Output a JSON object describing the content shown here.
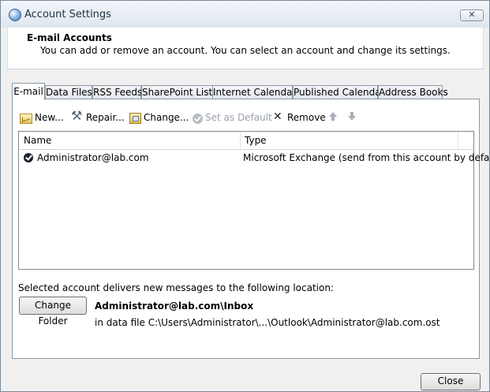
{
  "window": {
    "title": "Account Settings",
    "close_glyph": "✕"
  },
  "header": {
    "title": "E-mail Accounts",
    "description": "You can add or remove an account. You can select an account and change its settings."
  },
  "tabs": [
    {
      "label": "E-mail",
      "active": true
    },
    {
      "label": "Data Files",
      "active": false
    },
    {
      "label": "RSS Feeds",
      "active": false
    },
    {
      "label": "SharePoint Lists",
      "active": false
    },
    {
      "label": "Internet Calendars",
      "active": false
    },
    {
      "label": "Published Calendars",
      "active": false
    },
    {
      "label": "Address Books",
      "active": false
    }
  ],
  "toolbar": {
    "new_label": "New...",
    "repair_label": "Repair...",
    "change_label": "Change...",
    "set_default_label": "Set as Default",
    "remove_label": "Remove",
    "icons": {
      "new": "new-mail-icon",
      "repair": "repair-tools-icon",
      "change": "change-icon",
      "set_default": "check-circle-icon",
      "remove": "remove-x-icon",
      "move_up": "arrow-up-icon",
      "move_down": "arrow-down-icon"
    }
  },
  "accounts_list": {
    "columns": [
      "Name",
      "Type"
    ],
    "rows": [
      {
        "name": "Administrator@lab.com",
        "type": "Microsoft Exchange (send from this account by default)",
        "default": true
      }
    ]
  },
  "delivery": {
    "caption": "Selected account delivers new messages to the following location:",
    "change_folder_label": "Change Folder",
    "inbox_path": "Administrator@lab.com\\Inbox",
    "data_file": "in data file C:\\Users\\Administrator\\...\\Outlook\\Administrator@lab.com.ost"
  },
  "footer": {
    "close_label": "Close"
  },
  "colors": {
    "titlebar_top": "#f3f6fa",
    "titlebar_bottom": "#dfe6ee",
    "dialog_bg": "#f0f0f0",
    "border": "#8d99a6",
    "disabled_text": "#9ba3ad"
  }
}
